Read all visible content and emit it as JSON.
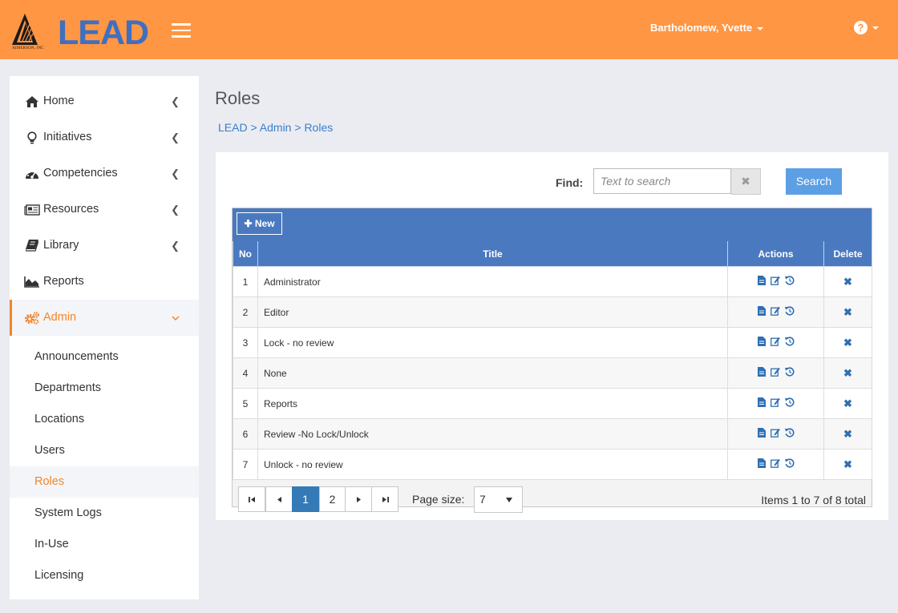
{
  "header": {
    "logo_text": "LEAD",
    "logo_sub": "AIMERSON, INC",
    "user_name": "Bartholomew, Yvette",
    "help_icon": "question-circle-icon",
    "colors": {
      "bar": "#ff9643",
      "logo_blue": "#3f6fbf"
    }
  },
  "sidebar": {
    "items": [
      {
        "label": "Home",
        "icon": "home-icon"
      },
      {
        "label": "Initiatives",
        "icon": "lightbulb-icon"
      },
      {
        "label": "Competencies",
        "icon": "dashboard-icon"
      },
      {
        "label": "Resources",
        "icon": "newspaper-icon"
      },
      {
        "label": "Library",
        "icon": "book-icon"
      },
      {
        "label": "Reports",
        "icon": "area-chart-icon"
      },
      {
        "label": "Admin",
        "icon": "cogs-icon"
      }
    ],
    "admin_sub": [
      "Announcements",
      "Departments",
      "Locations",
      "Users",
      "Roles",
      "System Logs",
      "In-Use",
      "Licensing"
    ],
    "active_sub": "Roles",
    "accent": "#f0862b"
  },
  "page": {
    "title": "Roles",
    "breadcrumb": [
      "LEAD",
      "Admin",
      "Roles"
    ],
    "breadcrumb_sep": ">"
  },
  "search": {
    "label": "Find:",
    "placeholder": "Text to search",
    "value": "",
    "clear": "✖",
    "button": "Search"
  },
  "grid": {
    "new_label": "New",
    "columns": [
      "No",
      "Title",
      "Actions",
      "Delete"
    ],
    "rows": [
      {
        "no": "1",
        "title": "Administrator"
      },
      {
        "no": "2",
        "title": "Editor"
      },
      {
        "no": "3",
        "title": "Lock - no review"
      },
      {
        "no": "4",
        "title": "None"
      },
      {
        "no": "5",
        "title": "Reports"
      },
      {
        "no": "6",
        "title": "Review -No Lock/Unlock"
      },
      {
        "no": "7",
        "title": "Unlock - no review"
      }
    ],
    "action_icons": [
      "document-icon",
      "edit-icon",
      "history-icon"
    ],
    "delete_icon": "delete-x-icon",
    "header_color": "#4a79c0"
  },
  "pager": {
    "pages": [
      "1",
      "2"
    ],
    "current": "1",
    "page_size_label": "Page size:",
    "page_size": "7",
    "items_text": "Items 1 to 7 of 8 total"
  }
}
